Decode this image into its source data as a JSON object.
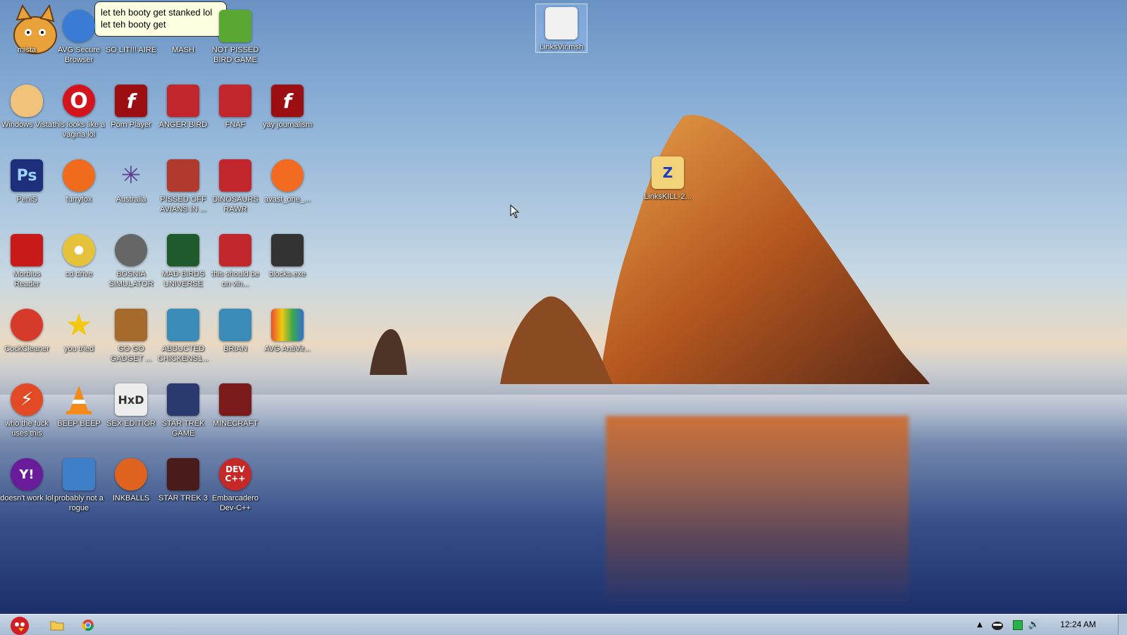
{
  "balloon": {
    "line1": "let teh booty get stanked lol",
    "line2": "let teh booty get"
  },
  "desktop": {
    "icons": [
      {
        "label": "mista",
        "color": "#e9a13a",
        "glyph": ""
      },
      {
        "label": "AVG Secure Browser",
        "color": "#3a7bd5",
        "glyph": ""
      },
      {
        "label": "SO LIT!!! AIRE",
        "color": "#888888",
        "glyph": ""
      },
      {
        "label": "MASH",
        "color": "#888888",
        "glyph": ""
      },
      {
        "label": "NOT PISSED BIRD GAME",
        "color": "#5aa832",
        "glyph": ""
      },
      {
        "label": "Windows Vista",
        "color": "#f1c27a",
        "glyph": ""
      },
      {
        "label": "this looks like a vagina lol",
        "color": "#d4141c",
        "glyph": "O"
      },
      {
        "label": "Porn Player",
        "color": "#9b0f12",
        "glyph": "f"
      },
      {
        "label": "ANGER BIRD",
        "color": "#c0262c",
        "glyph": ""
      },
      {
        "label": "FNAF",
        "color": "#c0262c",
        "glyph": ""
      },
      {
        "label": "yay journalism",
        "color": "#9b0f12",
        "glyph": "f"
      },
      {
        "label": "PeniS",
        "color": "#1d2f7a",
        "glyph": "Ps"
      },
      {
        "label": "furryfox",
        "color": "#f06b1c",
        "glyph": ""
      },
      {
        "label": "Australia",
        "color": "#5b3f8c",
        "glyph": ""
      },
      {
        "label": "PISSED OFF AVIANS IN ...",
        "color": "#b03a2e",
        "glyph": ""
      },
      {
        "label": "DINOSAURS RAWR",
        "color": "#c0262c",
        "glyph": ""
      },
      {
        "label": "avast_one_...",
        "color": "#f26b21",
        "glyph": ""
      },
      {
        "label": "Morbius Reader",
        "color": "#c91a1a",
        "glyph": ""
      },
      {
        "label": "cd drive",
        "color": "#e6c23a",
        "glyph": ""
      },
      {
        "label": "BOSNIA SIMULATOR",
        "color": "#666666",
        "glyph": ""
      },
      {
        "label": "MAD BIRDS UNIVERSE",
        "color": "#1f5a2d",
        "glyph": ""
      },
      {
        "label": "this should be on vin...",
        "color": "#c0262c",
        "glyph": ""
      },
      {
        "label": "blocks.exe",
        "color": "#333333",
        "glyph": ""
      },
      {
        "label": "CockCleaner",
        "color": "#d63a2a",
        "glyph": ""
      },
      {
        "label": "you tried",
        "color": "#f2c811",
        "glyph": "★"
      },
      {
        "label": "GO GO GADGET ...",
        "color": "#a56a2c",
        "glyph": ""
      },
      {
        "label": "ABDUCTED CHICKENS1...",
        "color": "#3a8bb8",
        "glyph": ""
      },
      {
        "label": "BRIAN",
        "color": "#3a8bb8",
        "glyph": ""
      },
      {
        "label": "AVG AntiVir...",
        "color": "#e94f2c",
        "glyph": ""
      },
      {
        "label": "who the fuck uses this",
        "color": "#e24a25",
        "glyph": "⚡"
      },
      {
        "label": "BEEP BEEP",
        "color": "#f38a1a",
        "glyph": ""
      },
      {
        "label": "SEX EDITIOR",
        "color": "#ededed",
        "glyph": "HxD"
      },
      {
        "label": "STAR TREK GAME",
        "color": "#2b3a6e",
        "glyph": ""
      },
      {
        "label": "MINECRAFT",
        "color": "#7a1a1a",
        "glyph": ""
      },
      {
        "label": "doesn't work lol",
        "color": "#6a1b9a",
        "glyph": "Y!"
      },
      {
        "label": "probably not a rogue",
        "color": "#3d7fc9",
        "glyph": ""
      },
      {
        "label": "INKBALLS",
        "color": "#e0621f",
        "glyph": ""
      },
      {
        "label": "STAR TREK 3",
        "color": "#4a1b1b",
        "glyph": ""
      },
      {
        "label": "Embarcadero Dev-C++",
        "color": "#c62828",
        "glyph": "DEV C++"
      },
      {
        "label": "LinksVir.msh",
        "color": "#f0f0f0",
        "glyph": ""
      },
      {
        "label": "LinksKILL-2...",
        "color": "#f2d37a",
        "glyph": "Z"
      }
    ]
  },
  "taskbar": {
    "clock": "12:24 AM"
  }
}
